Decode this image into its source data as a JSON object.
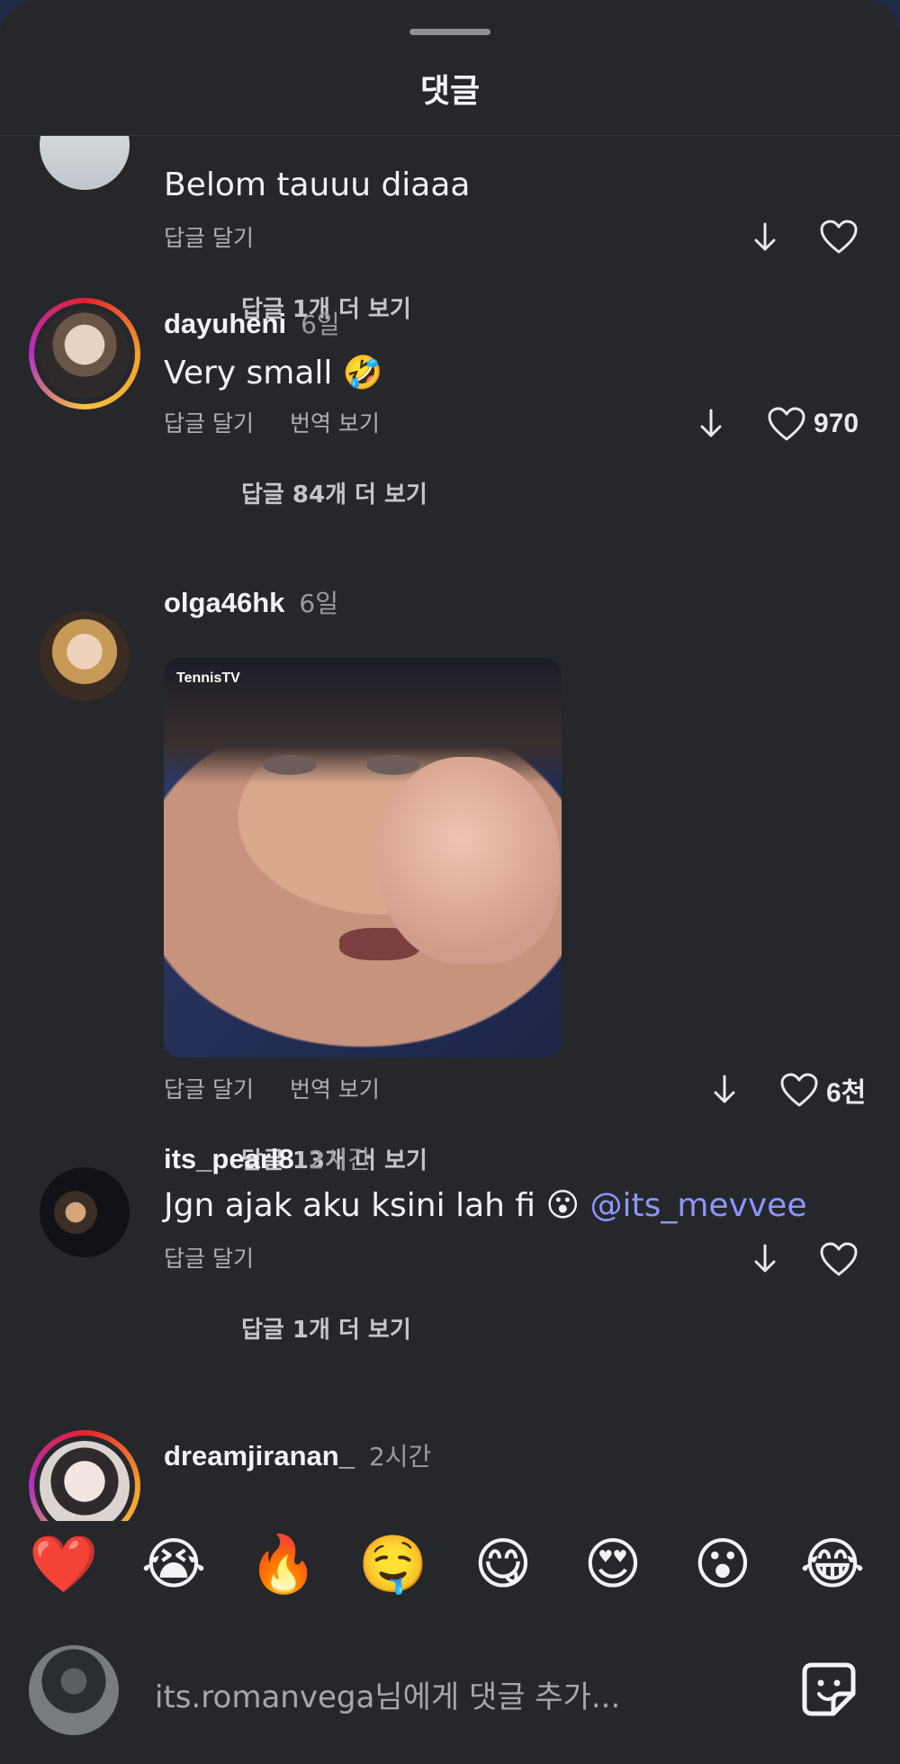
{
  "header": {
    "title": "댓글"
  },
  "labels": {
    "reply": "답글 달기",
    "translate": "번역 보기"
  },
  "comments": [
    {
      "username": "",
      "time": "",
      "text": "Belom tauuu diaaa",
      "likes": "",
      "more_replies": "답글 1개 더 보기",
      "translate": false
    },
    {
      "username": "dayuheni",
      "time": "6일",
      "text": "Very small 🤣",
      "likes": "970",
      "more_replies": "답글 84개 더 보기",
      "translate": true,
      "story_ring": true
    },
    {
      "username": "olga46hk",
      "time": "6일",
      "text": "",
      "gif_logo": "TennisTV",
      "likes": "6천",
      "more_replies": "답글 13개 더 보기",
      "translate": true
    },
    {
      "username": "its_pearl8",
      "time": "2시간",
      "text": "Jgn ajak aku ksini lah fi 😮 ",
      "mention": "@its_mevvee",
      "likes": "",
      "more_replies": "답글 1개 더 보기",
      "translate": false
    },
    {
      "username": "dreamjiranan_",
      "time": "2시간",
      "story_ring": true
    }
  ],
  "reactions": [
    "❤️",
    "😭",
    "🔥",
    "🤤",
    "😋",
    "😍",
    "😮",
    "😂"
  ],
  "composer": {
    "placeholder": "its.romanvega님에게 댓글 추가..."
  },
  "colors": {
    "background": "#25272b",
    "mention": "#8c96ff",
    "ring": "#e4222e"
  }
}
